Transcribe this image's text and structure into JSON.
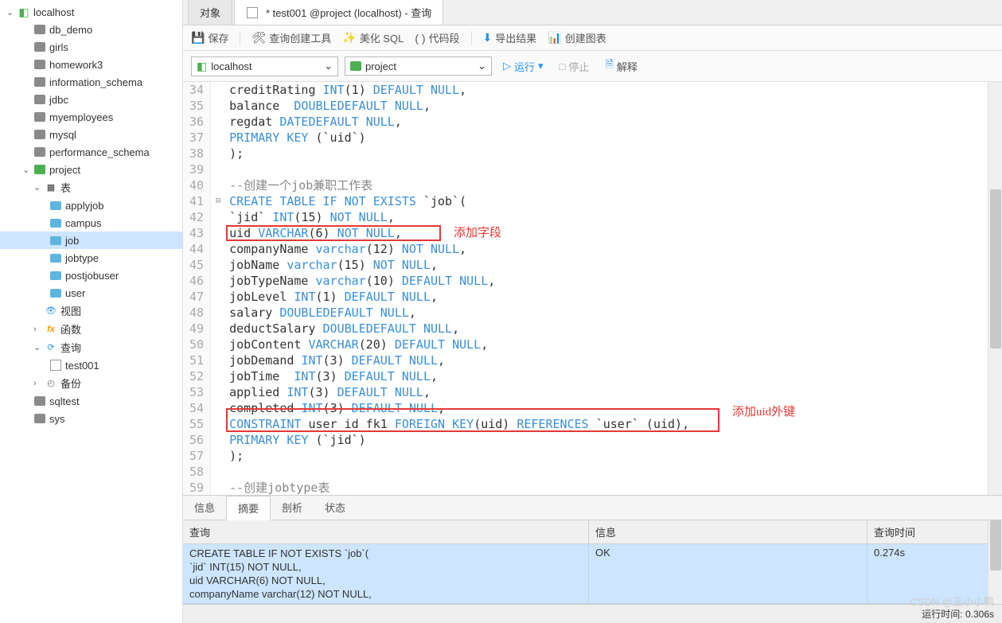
{
  "tree": {
    "root": "localhost",
    "db_demo": "db_demo",
    "girls": "girls",
    "homework3": "homework3",
    "information_schema": "information_schema",
    "jdbc": "jdbc",
    "myemployees": "myemployees",
    "mysql": "mysql",
    "performance_schema": "performance_schema",
    "project": "project",
    "tables": "表",
    "applyjob": "applyjob",
    "campus": "campus",
    "job": "job",
    "jobtype": "jobtype",
    "postjobuser": "postjobuser",
    "user": "user",
    "views": "视图",
    "functions": "函数",
    "queries": "查询",
    "test001": "test001",
    "backup": "备份",
    "sqltest": "sqltest",
    "sys": "sys"
  },
  "tabs": {
    "objects": "对象",
    "query_tab": "* test001 @project (localhost) - 查询"
  },
  "toolbar": {
    "save": "保存",
    "query_builder": "查询创建工具",
    "beautify": "美化 SQL",
    "snippet": "代码段",
    "export": "导出结果",
    "chart": "创建图表"
  },
  "connbar": {
    "conn": "localhost",
    "db": "project",
    "run": "运行",
    "stop": "停止",
    "explain": "解释"
  },
  "code": {
    "lines": [
      {
        "n": 34,
        "html": "creditRating <span class='ty'>INT</span>(<span class='num'>1</span>) <span class='kw'>DEFAULT NULL</span>,"
      },
      {
        "n": 35,
        "html": "balance  <span class='ty'>DOUBLE</span> <span class='kw'>DEFAULT NULL</span>,"
      },
      {
        "n": 36,
        "html": "regdat <span class='ty'>DATE</span> <span class='kw'>DEFAULT NULL</span>,"
      },
      {
        "n": 37,
        "html": "<span class='kw'>PRIMARY KEY</span> (`uid`)"
      },
      {
        "n": 38,
        "html": ");"
      },
      {
        "n": 39,
        "html": ""
      },
      {
        "n": 40,
        "html": "<span class='cm'>--创建一个job兼职工作表</span>"
      },
      {
        "n": 41,
        "html": "<span class='kw'>CREATE TABLE IF NOT EXISTS</span> `job`(",
        "fold": true
      },
      {
        "n": 42,
        "html": "`jid` <span class='ty'>INT</span>(<span class='num'>15</span>) <span class='kw'>NOT NULL</span>,"
      },
      {
        "n": 43,
        "html": "uid <span class='ty'>VARCHAR</span>(<span class='num'>6</span>) <span class='kw'>NOT NULL</span>,"
      },
      {
        "n": 44,
        "html": "companyName <span class='ty'>varchar</span>(<span class='num'>12</span>) <span class='kw'>NOT NULL</span>,"
      },
      {
        "n": 45,
        "html": "jobName <span class='ty'>varchar</span>(<span class='num'>15</span>) <span class='kw'>NOT NULL</span>,"
      },
      {
        "n": 46,
        "html": "jobTypeName <span class='ty'>varchar</span>(<span class='num'>10</span>) <span class='kw'>DEFAULT NULL</span>,"
      },
      {
        "n": 47,
        "html": "jobLevel <span class='ty'>INT</span>(<span class='num'>1</span>) <span class='kw'>DEFAULT NULL</span>,"
      },
      {
        "n": 48,
        "html": "salary <span class='ty'>DOUBLE</span> <span class='kw'>DEFAULT NULL</span>,"
      },
      {
        "n": 49,
        "html": "deductSalary <span class='ty'>DOUBLE</span> <span class='kw'>DEFAULT NULL</span>,"
      },
      {
        "n": 50,
        "html": "jobContent <span class='ty'>VARCHAR</span>(<span class='num'>20</span>) <span class='kw'>DEFAULT NULL</span>,"
      },
      {
        "n": 51,
        "html": "jobDemand <span class='ty'>INT</span>(<span class='num'>3</span>) <span class='kw'>DEFAULT NULL</span>,"
      },
      {
        "n": 52,
        "html": "jobTime  <span class='ty'>INT</span>(<span class='num'>3</span>) <span class='kw'>DEFAULT NULL</span>,"
      },
      {
        "n": 53,
        "html": "applied <span class='ty'>INT</span>(<span class='num'>3</span>) <span class='kw'>DEFAULT NULL</span>,"
      },
      {
        "n": 54,
        "html": "completed <span class='ty'>INT</span>(<span class='num'>3</span>) <span class='kw'>DEFAULT NULL</span>,"
      },
      {
        "n": 55,
        "html": "<span class='kw'>CONSTRAINT</span> user_id_fk1 <span class='kw'>FOREIGN KEY</span>(uid) <span class='kw'>REFERENCES</span> `user` (uid),"
      },
      {
        "n": 56,
        "html": "<span class='kw'>PRIMARY KEY</span> (`jid`)"
      },
      {
        "n": 57,
        "html": ");"
      },
      {
        "n": 58,
        "html": ""
      },
      {
        "n": 59,
        "html": "<span class='cm'>--创建jobtype表</span>"
      }
    ],
    "annotation1": "添加字段",
    "annotation2": "添加uid外键"
  },
  "bottom": {
    "info": "信息",
    "summary": "摘要",
    "analyze": "剖析",
    "status": "状态"
  },
  "grid": {
    "h1": "查询",
    "h2": "信息",
    "h3": "查询时间",
    "query_text": "CREATE TABLE IF NOT EXISTS `job`(\n`jid` INT(15) NOT NULL,\nuid VARCHAR(6) NOT NULL,\ncompanyName varchar(12) NOT NULL,",
    "info_text": "OK",
    "time_text": "0.274s"
  },
  "status": "运行时间: 0.306s",
  "watermark": "CSDN @王小小鸭"
}
